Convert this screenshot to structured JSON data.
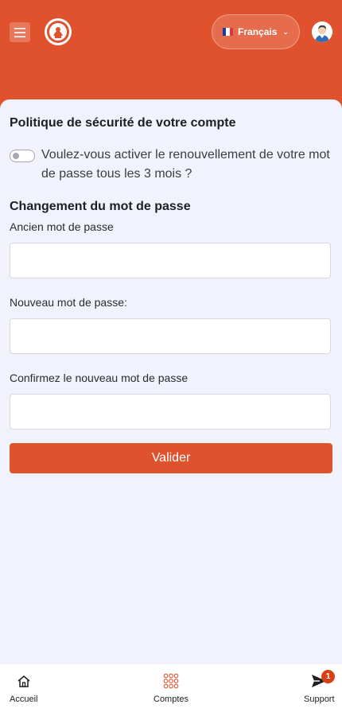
{
  "colors": {
    "brand": "#e0522d",
    "background": "#f1f2fb",
    "badge": "#d84016"
  },
  "header": {
    "menu_icon": "hamburger-menu-icon",
    "logo_icon": "bank-logo-icon",
    "language": {
      "label": "Français",
      "flag": "france-flag-icon",
      "chevron": "chevron-down-icon"
    },
    "avatar_icon": "user-avatar-icon"
  },
  "security_policy": {
    "title": "Politique de sécurité de votre compte",
    "toggle_label": "Voulez-vous activer le renouvellement de votre mot de passe tous les 3 mois ?",
    "toggle_on": false
  },
  "password_change": {
    "title": "Changement du mot de passe",
    "fields": [
      {
        "label": "Ancien mot de passe",
        "value": "",
        "placeholder": ""
      },
      {
        "label": "Nouveau mot de passe:",
        "value": "",
        "placeholder": ""
      },
      {
        "label": "Confirmez le nouveau mot de passe",
        "value": "",
        "placeholder": ""
      }
    ],
    "submit_label": "Valider"
  },
  "bottom_nav": {
    "items": [
      {
        "label": "Accueil",
        "icon": "home-icon"
      },
      {
        "label": "Comptes",
        "icon": "grid-dots-icon"
      },
      {
        "label": "Support",
        "icon": "send-icon",
        "badge": "1"
      }
    ]
  }
}
